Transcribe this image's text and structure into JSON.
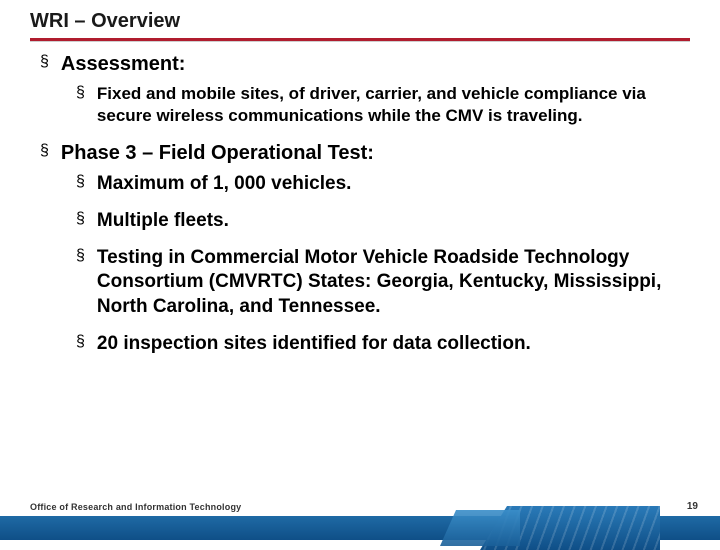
{
  "title": "WRI – Overview",
  "sections": [
    {
      "heading": "Assessment:",
      "items": [
        {
          "text": "Fixed and mobile sites, of driver, carrier,  and vehicle compliance via secure wireless communications while the CMV is traveling.",
          "style": "sub1"
        }
      ]
    },
    {
      "heading": "Phase 3 – Field Operational Test:",
      "items": [
        {
          "text": "Maximum of 1, 000 vehicles.",
          "style": "sub2"
        },
        {
          "text": "Multiple fleets.",
          "style": "sub2"
        },
        {
          "text": "Testing in Commercial Motor Vehicle Roadside Technology Consortium (CMVRTC) States: Georgia, Kentucky, Mississippi, North Carolina, and Tennessee.",
          "style": "sub2"
        },
        {
          "text": "20 inspection sites identified for data collection.",
          "style": "sub2"
        }
      ]
    }
  ],
  "footer_text": "Office of Research and Information Technology",
  "page_number": "19",
  "bullet_glyph": "§"
}
